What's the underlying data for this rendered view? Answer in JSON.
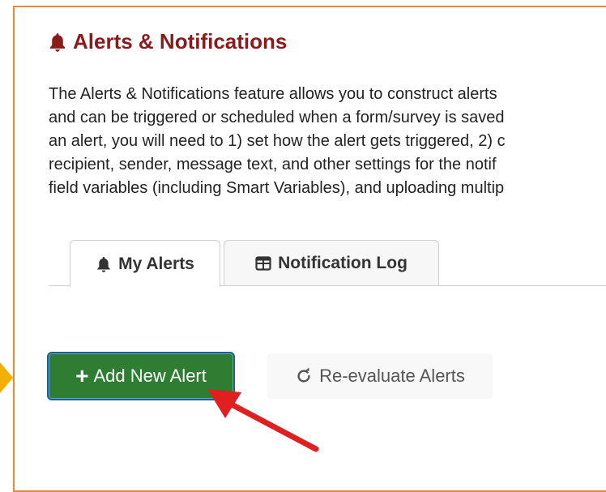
{
  "header": {
    "title": "Alerts & Notifications"
  },
  "description_lines": [
    "The Alerts & Notifications feature allows you to construct alerts",
    "and can be triggered or scheduled when a form/survey is saved",
    "an alert, you will need to 1) set how the alert gets triggered, 2) c",
    "recipient, sender, message text, and other settings for the notif",
    "field variables (including Smart Variables), and uploading multip"
  ],
  "tabs": [
    {
      "label": "My Alerts",
      "icon": "bell-icon",
      "active": true
    },
    {
      "label": "Notification Log",
      "icon": "table-icon",
      "active": false
    }
  ],
  "buttons": {
    "add_new_alert": "Add New Alert",
    "reevaluate_alerts": "Re-evaluate Alerts"
  },
  "colors": {
    "title": "#8b1a1a",
    "add_button": "#2e7d32",
    "frame_border": "#e48a3a",
    "annotation_arrow": "#e02020",
    "side_marker": "#f3b000"
  }
}
